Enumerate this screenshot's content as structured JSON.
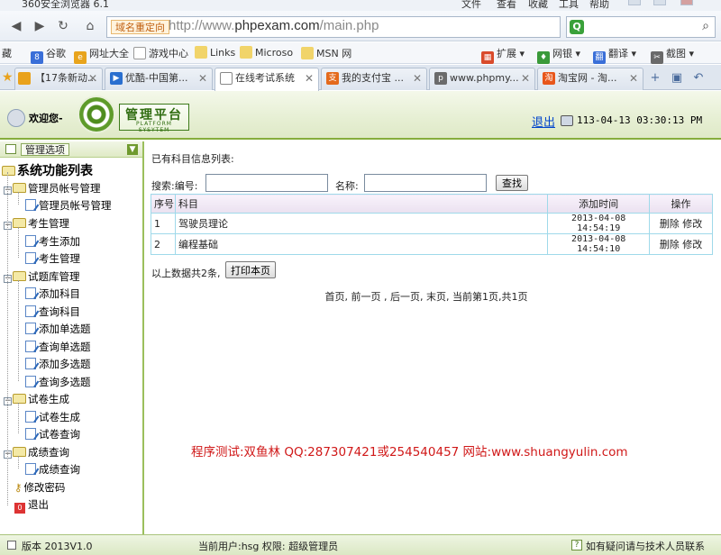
{
  "browser": {
    "app_title": "360安全浏览器 6.1",
    "menu": [
      "文件",
      "查看",
      "收藏",
      "工具",
      "帮助"
    ],
    "redirect_tag": "域名重定向",
    "url_prefix": "http://www.",
    "url_host": "phpexam.com",
    "url_path": "/main.php",
    "bookmarks": [
      "藏",
      "谷歌",
      "网址大全",
      "游戏中心",
      "Links",
      "Microso",
      "MSN 网"
    ],
    "toolbar_right": [
      "扩展",
      "网银",
      "翻译",
      "截图"
    ],
    "tabs": [
      {
        "label": "【17条新动...",
        "icon_color": "#e9a21c",
        "active": false
      },
      {
        "label": "优酷-中国第...",
        "icon_color": "#2a6fcf",
        "active": false
      },
      {
        "label": "在线考试系统",
        "icon_color": "#888888",
        "active": true
      },
      {
        "label": "我的支付宝 ...",
        "icon_color": "#e46a1c",
        "active": false
      },
      {
        "label": "www.phpmy...",
        "icon_color": "#6b6b6b",
        "active": false
      },
      {
        "label": "淘宝网 - 淘...",
        "icon_color": "#e8561b",
        "active": false
      }
    ]
  },
  "header": {
    "welcome": "欢迎您-",
    "logo_cn": "管理平台",
    "logo_en": "PLATFORM SYSYTEM",
    "logout": "退出",
    "datetime": "113-04-13 03:30:13 PM"
  },
  "sidebar": {
    "options_label": "管理选项",
    "root": "系统功能列表",
    "groups": [
      {
        "label": "管理员帐号管理",
        "items": [
          "管理员帐号管理"
        ]
      },
      {
        "label": "考生管理",
        "items": [
          "考生添加",
          "考生管理"
        ]
      },
      {
        "label": "试题库管理",
        "items": [
          "添加科目",
          "查询科目",
          "添加单选题",
          "查询单选题",
          "添加多选题",
          "查询多选题"
        ]
      },
      {
        "label": "试卷生成",
        "items": [
          "试卷生成",
          "试卷查询"
        ]
      },
      {
        "label": "成绩查询",
        "items": [
          "成绩查询"
        ]
      }
    ],
    "change_password": "修改密码",
    "exit": "退出"
  },
  "main": {
    "list_title": "已有科目信息列表:",
    "search_label": "搜索:编号:",
    "id_value": "",
    "name_label": "名称:",
    "name_value": "",
    "query_button": "查找",
    "table": {
      "headers": [
        "序号",
        "科目",
        "添加时间",
        "操作"
      ],
      "rows": [
        {
          "no": "1",
          "subject": "驾驶员理论",
          "time": "2013-04-08 14:54:19",
          "delete": "删除",
          "edit": "修改"
        },
        {
          "no": "2",
          "subject": "编程基础",
          "time": "2013-04-08 14:54:10",
          "delete": "删除",
          "edit": "修改"
        }
      ]
    },
    "count_text": "以上数据共2条,",
    "print_button": "打印本页",
    "pager": "首页, 前一页 , 后一页, 末页, 当前第1页,共1页",
    "watermark": "程序测试:双鱼林 QQ:287307421或254540457 网站:www.shuangyulin.com"
  },
  "status": {
    "version": "版本 2013V1.0",
    "current_user": "当前用户:hsg 权限: 超级管理员",
    "help": "如有疑问请与技术人员联系"
  }
}
